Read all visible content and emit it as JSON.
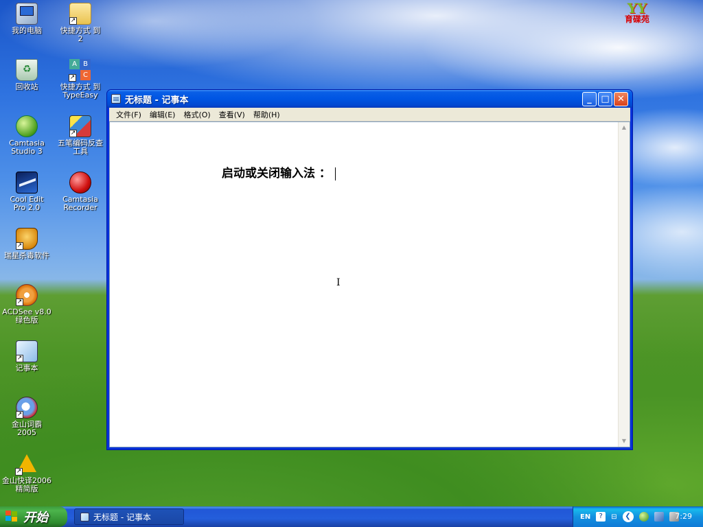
{
  "desktop": {
    "icons": [
      {
        "label": "我的电脑"
      },
      {
        "label": "快捷方式 到\n2"
      },
      {
        "label": "回收站"
      },
      {
        "label": "快捷方式 到\nTypeEasy"
      },
      {
        "label": "Camtasia\nStudio 3"
      },
      {
        "label": "五笔编码反查\n工具"
      },
      {
        "label": "Cool Edit\nPro 2.0"
      },
      {
        "label": "Camtasia\nRecorder"
      },
      {
        "label": "瑞星杀毒软件"
      },
      {
        "label": "ACDSee v8.0\n绿色版"
      },
      {
        "label": "记事本"
      },
      {
        "label": "金山词霸\n2005"
      },
      {
        "label": "金山快译2006\n精简版"
      }
    ],
    "logo": {
      "mark": "YY",
      "text": "育碟苑"
    }
  },
  "window": {
    "title": "无标题 - 记事本",
    "buttons": {
      "minimize": "_",
      "maximize": "□",
      "close": "✕"
    },
    "menu": [
      "文件(F)",
      "编辑(E)",
      "格式(O)",
      "查看(V)",
      "帮助(H)"
    ],
    "content": "启动或关闭输入法 ：",
    "cursor_glyph": "I"
  },
  "taskbar": {
    "start_label": "开始",
    "task_item_label": "无标题 - 记事本",
    "tray": {
      "lang": "EN",
      "help": "?",
      "clock": "7:29"
    }
  }
}
